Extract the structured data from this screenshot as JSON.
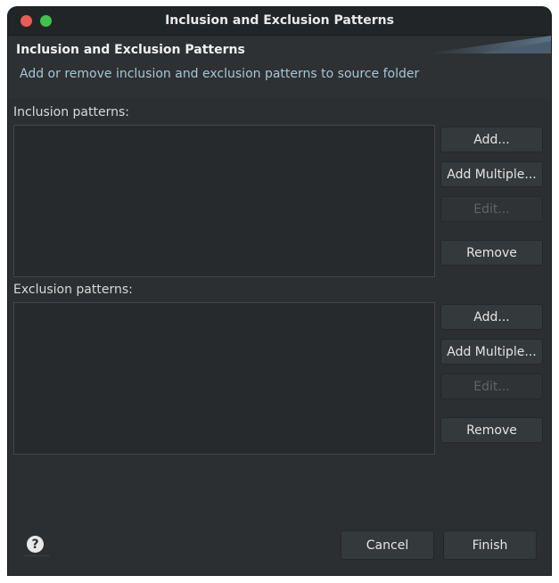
{
  "window": {
    "title": "Inclusion and Exclusion Patterns"
  },
  "banner": {
    "title": "Inclusion and Exclusion Patterns",
    "description": "Add or remove inclusion and exclusion patterns to source folder"
  },
  "inclusion": {
    "label": "Inclusion patterns:",
    "items": [],
    "buttons": {
      "add": "Add...",
      "add_multiple": "Add Multiple...",
      "edit": "Edit...",
      "remove": "Remove"
    }
  },
  "exclusion": {
    "label": "Exclusion patterns:",
    "items": [],
    "buttons": {
      "add": "Add...",
      "add_multiple": "Add Multiple...",
      "edit": "Edit...",
      "remove": "Remove"
    }
  },
  "footer": {
    "help": "?",
    "cancel": "Cancel",
    "finish": "Finish"
  },
  "icons": {
    "close": "close-icon",
    "zoom": "zoom-icon",
    "help": "help-icon"
  },
  "colors": {
    "window_bg": "#2b2f31",
    "close": "#ee5b55",
    "zoom": "#3fc14c",
    "description": "#a8c4d6"
  }
}
